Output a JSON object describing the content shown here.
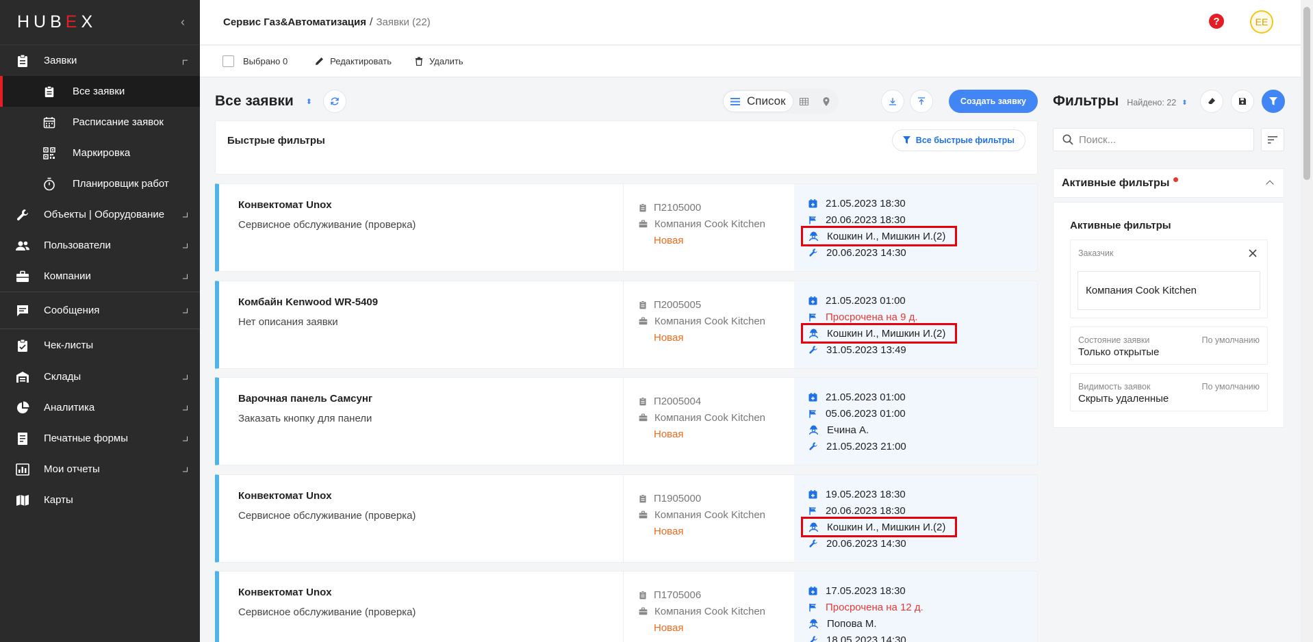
{
  "sidebar": {
    "logo": {
      "pre": "HUB",
      "accent": "E",
      "post": "X"
    },
    "collapse_glyph": "‹",
    "items": [
      {
        "label": "Заявки",
        "icon": "clipboard-icon"
      },
      {
        "label": "Все заявки",
        "icon": "clipboard-icon"
      },
      {
        "label": "Расписание заявок",
        "icon": "calendar-icon"
      },
      {
        "label": "Маркировка",
        "icon": "qr-code-icon"
      },
      {
        "label": "Планировщик работ",
        "icon": "stopwatch-icon"
      },
      {
        "label": "Объекты | Оборудование",
        "icon": "wrench-icon"
      },
      {
        "label": "Пользователи",
        "icon": "users-icon"
      },
      {
        "label": "Компании",
        "icon": "briefcase-icon"
      },
      {
        "label": "Сообщения",
        "icon": "chat-icon"
      },
      {
        "label": "Чек-листы",
        "icon": "checklist-icon"
      },
      {
        "label": "Склады",
        "icon": "warehouse-icon"
      },
      {
        "label": "Аналитика",
        "icon": "pie-chart-icon"
      },
      {
        "label": "Печатные формы",
        "icon": "print-form-icon"
      },
      {
        "label": "Мои отчеты",
        "icon": "report-icon"
      },
      {
        "label": "Карты",
        "icon": "map-icon"
      }
    ]
  },
  "header": {
    "crumb_main": "Сервис Газ&Автоматизация",
    "crumb_sep": "/",
    "crumb_sub": "Заявки (22)",
    "help_glyph": "?",
    "avatar_initials": "EE"
  },
  "toolbar": {
    "selected": "Выбрано 0",
    "edit": "Редактировать",
    "delete": "Удалить"
  },
  "main": {
    "title": "Все заявки",
    "sort_glyph": "⬍",
    "view_list": "Список",
    "create": "Создать заявку",
    "quick_filters_title": "Быстрые фильтры",
    "all_quick_filters": "Все быстрые фильтры"
  },
  "cards": [
    {
      "title": "Конвектомат Unox",
      "desc": "Сервисное обслуживание (проверка)",
      "code": "П2105000",
      "company": "Компания Cook Kitchen",
      "status": "Новая",
      "created": "21.05.2023 18:30",
      "deadline": "20.06.2023 18:30",
      "deadline_overdue": false,
      "assignees": "Кошкин И., Мишкин И.(2)",
      "highlighted": true,
      "work": "20.06.2023 14:30"
    },
    {
      "title": "Комбайн Kenwood WR-5409",
      "desc": "Нет описания заявки",
      "code": "П2005005",
      "company": "Компания Cook Kitchen",
      "status": "Новая",
      "created": "21.05.2023 01:00",
      "deadline": "Просрочена на 9 д.",
      "deadline_overdue": true,
      "assignees": "Кошкин И., Мишкин И.(2)",
      "highlighted": true,
      "work": "31.05.2023 13:49"
    },
    {
      "title": "Варочная панель Самсунг",
      "desc": "Заказать кнопку для панели",
      "code": "П2005004",
      "company": "Компания Cook Kitchen",
      "status": "Новая",
      "created": "21.05.2023 01:00",
      "deadline": "05.06.2023 01:00",
      "deadline_overdue": false,
      "assignees": "Ечина А.",
      "highlighted": false,
      "work": "21.05.2023 21:00"
    },
    {
      "title": "Конвектомат Unox",
      "desc": "Сервисное обслуживание (проверка)",
      "code": "П1905000",
      "company": "Компания Cook Kitchen",
      "status": "Новая",
      "created": "19.05.2023 18:30",
      "deadline": "20.06.2023 18:30",
      "deadline_overdue": false,
      "assignees": "Кошкин И., Мишкин И.(2)",
      "highlighted": true,
      "work": "20.06.2023 14:30"
    },
    {
      "title": "Конвектомат Unox",
      "desc": "Сервисное обслуживание (проверка)",
      "code": "П1705006",
      "company": "Компания Cook Kitchen",
      "status": "Новая",
      "created": "17.05.2023 18:30",
      "deadline": "Просрочена на 12 д.",
      "deadline_overdue": true,
      "assignees": "Попова М.",
      "highlighted": false,
      "work": "18.05.2023 14:30"
    }
  ],
  "filters": {
    "title": "Фильтры",
    "found": "Найдено: 22",
    "search_placeholder": "Поиск...",
    "active_header": "Активные фильтры",
    "active_title": "Активные фильтры",
    "customer_label": "Заказчик",
    "customer_value": "Компания Cook Kitchen",
    "state_label": "Состояние заявки",
    "state_default": "По умолчанию",
    "state_value": "Только открытые",
    "visibility_label": "Видимость заявок",
    "visibility_default": "По умолчанию",
    "visibility_value": "Скрыть удаленные"
  },
  "colors": {
    "accent_red": "#e31e24",
    "primary_blue": "#4285f4",
    "status_new": "#f06a1a",
    "overdue_red": "#e53935",
    "card_stripe": "#4fb3ea"
  }
}
